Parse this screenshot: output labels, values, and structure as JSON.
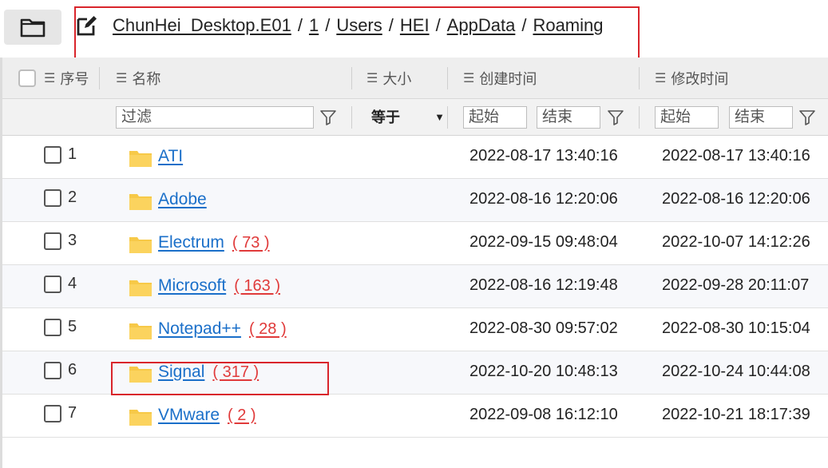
{
  "breadcrumb": [
    "ChunHei_Desktop.E01",
    "1",
    "Users",
    "HEI",
    "AppData",
    "Roaming"
  ],
  "breadcrumb_separator": "/",
  "columns": {
    "index": "序号",
    "name": "名称",
    "size": "大小",
    "created": "创建时间",
    "modified": "修改时间"
  },
  "filters": {
    "name_placeholder": "过滤",
    "size_operator": "等于",
    "created_start": "起始",
    "created_end": "结束",
    "modified_start": "起始",
    "modified_end": "结束"
  },
  "rows": [
    {
      "index": "1",
      "name": "ATI",
      "count": "",
      "created": "2022-08-17 13:40:16",
      "modified": "2022-08-17 13:40:16"
    },
    {
      "index": "2",
      "name": "Adobe",
      "count": "",
      "created": "2022-08-16 12:20:06",
      "modified": "2022-08-16 12:20:06"
    },
    {
      "index": "3",
      "name": "Electrum",
      "count": "( 73 )",
      "created": "2022-09-15 09:48:04",
      "modified": "2022-10-07 14:12:26"
    },
    {
      "index": "4",
      "name": "Microsoft",
      "count": "( 163 )",
      "created": "2022-08-16 12:19:48",
      "modified": "2022-09-28 20:11:07"
    },
    {
      "index": "5",
      "name": "Notepad++",
      "count": "( 28 )",
      "created": "2022-08-30 09:57:02",
      "modified": "2022-08-30 10:15:04"
    },
    {
      "index": "6",
      "name": "Signal",
      "count": "( 317 )",
      "created": "2022-10-20 10:48:13",
      "modified": "2022-10-24 10:44:08"
    },
    {
      "index": "7",
      "name": "VMware",
      "count": "( 2 )",
      "created": "2022-09-08 16:12:10",
      "modified": "2022-10-21 18:17:39"
    }
  ],
  "colors": {
    "link": "#1a6fc9",
    "count": "#e03a3a",
    "highlight": "#d9252b",
    "folder": "#f7c948"
  },
  "icons": [
    "folder-icon",
    "edit-icon",
    "list-icon",
    "filter-icon",
    "dropdown-arrow-icon"
  ]
}
